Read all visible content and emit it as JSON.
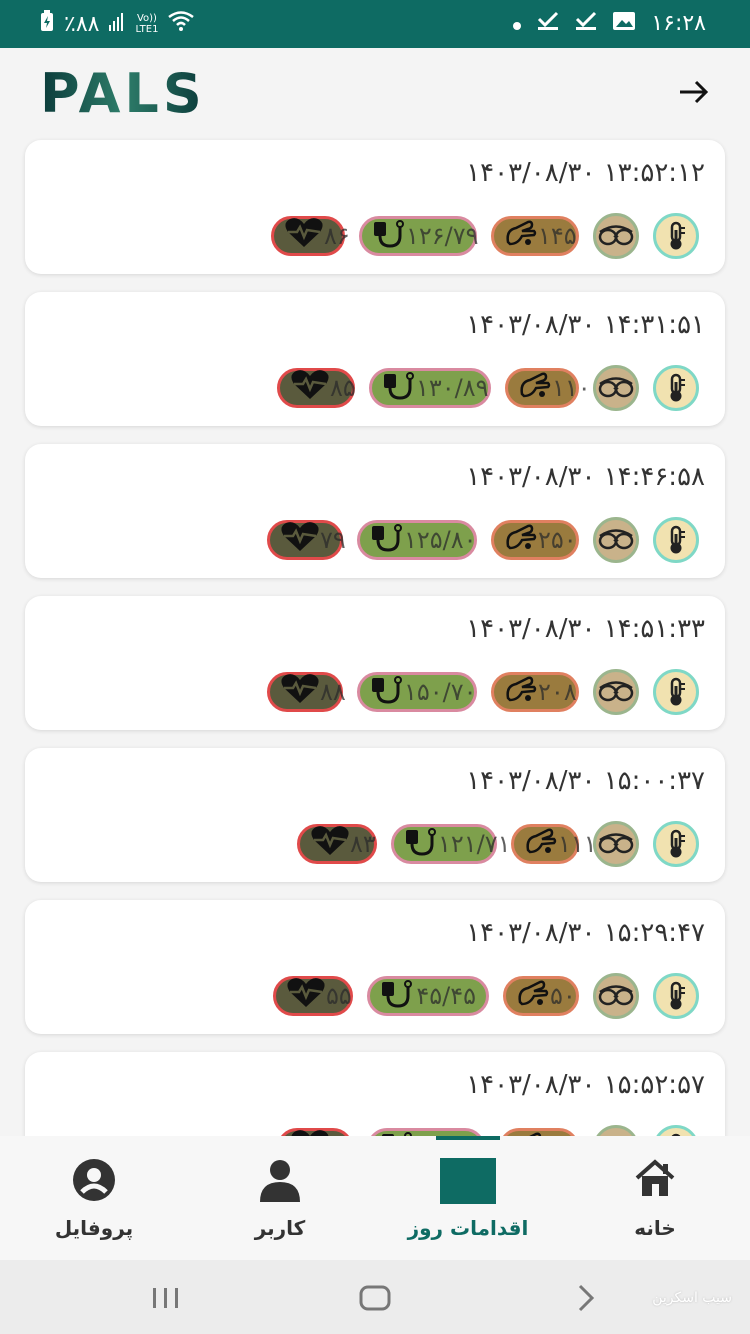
{
  "status_bar": {
    "battery": "٪۸۸",
    "network": [
      "Vo))",
      "LTE1"
    ],
    "time": "۱۶:۲۸"
  },
  "app_bar": {
    "logo_text": "PALS",
    "back_icon": "arrow-right-icon"
  },
  "records": [
    {
      "datetime": "۱۴۰۳/۰۸/۳۰ ۱۳:۵۲:۱۲",
      "sugar": "۱۴۵",
      "bp": "۱۲۶/۷۹",
      "hr": "۸۶"
    },
    {
      "datetime": "۱۴۰۳/۰۸/۳۰ ۱۴:۳۱:۵۱",
      "sugar": "۱۱۰",
      "bp": "۱۳۰/۸۹",
      "hr": "۸۵"
    },
    {
      "datetime": "۱۴۰۳/۰۸/۳۰ ۱۴:۴۶:۵۸",
      "sugar": "۲۵۰",
      "bp": "۱۲۵/۸۰",
      "hr": "۷۹"
    },
    {
      "datetime": "۱۴۰۳/۰۸/۳۰ ۱۴:۵۱:۳۳",
      "sugar": "۲۰۸",
      "bp": "۱۵۰/۷۰",
      "hr": "۸۸"
    },
    {
      "datetime": "۱۴۰۳/۰۸/۳۰ ۱۵:۰۰:۳۷",
      "sugar": "۱۱۱",
      "bp": "۱۲۱/۷۱",
      "hr": "۸۳"
    },
    {
      "datetime": "۱۴۰۳/۰۸/۳۰ ۱۵:۲۹:۴۷",
      "sugar": "۵۰",
      "bp": "۴۵/۴۵",
      "hr": "۵۵"
    },
    {
      "datetime": "۱۴۰۳/۰۸/۳۰ ۱۵:۵۲:۵۷",
      "sugar": "",
      "bp": "",
      "hr": ""
    }
  ],
  "bottom_nav": {
    "home": "خانه",
    "daily_actions": "اقدامات روز",
    "user": "کاربر",
    "profile": "پروفایل",
    "active": "daily_actions"
  },
  "watermark": "سیب اسکرین",
  "colors": {
    "primary": "#0e6b63",
    "sugar_pill": "#9a7b3e",
    "bp_pill": "#7ea04c",
    "hr_pill": "#5a5a3d"
  }
}
